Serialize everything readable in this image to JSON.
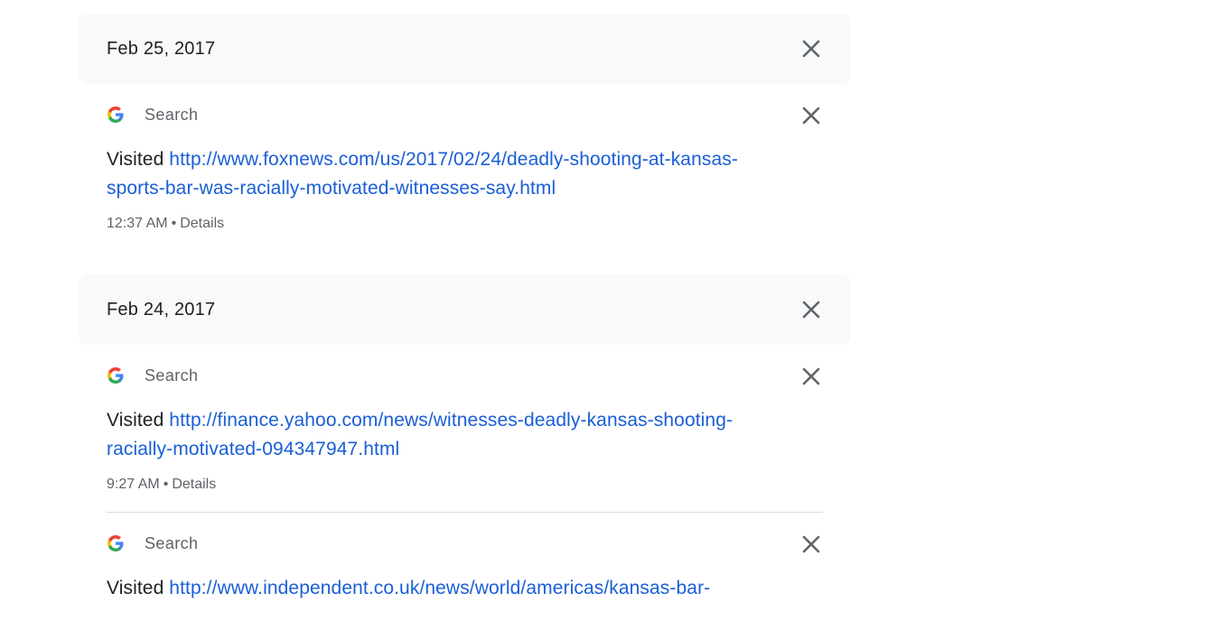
{
  "days": [
    {
      "date": "Feb 25, 2017",
      "entries": [
        {
          "product": "Search",
          "verb": "Visited",
          "url": "http://www.foxnews.com/us/2017/02/24/deadly-shooting-at-kansas-sports-bar-was-racially-motivated-witnesses-say.html",
          "time": "12:37 AM",
          "details": "Details"
        }
      ]
    },
    {
      "date": "Feb 24, 2017",
      "entries": [
        {
          "product": "Search",
          "verb": "Visited",
          "url": "http://finance.yahoo.com/news/witnesses-deadly-kansas-shooting-racially-motivated-094347947.html",
          "time": "9:27 AM",
          "details": "Details"
        },
        {
          "product": "Search",
          "verb": "Visited",
          "url": "http://www.independent.co.uk/news/world/americas/kansas-bar-",
          "time": "",
          "details": ""
        }
      ]
    }
  ],
  "separator": "•",
  "icons": {
    "close": "close-icon",
    "product": "google-g-icon"
  },
  "colors": {
    "link": "#1a5fd6",
    "header_bg": "#f8f9fa",
    "muted": "#5f6368"
  }
}
